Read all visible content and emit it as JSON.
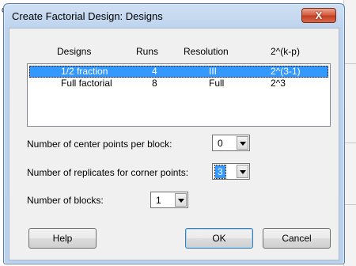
{
  "background": {
    "fragment_top": "C",
    "fragment_side": "ı"
  },
  "dialog": {
    "title": "Create Factorial Design: Designs",
    "close_label": "X",
    "columns": [
      "Designs",
      "Runs",
      "Resolution",
      "2^(k-p)"
    ],
    "designs": [
      {
        "design": "1/2 fraction",
        "runs": "4",
        "resolution": "III",
        "kp": "2^(3-1)",
        "selected": true
      },
      {
        "design": "Full factorial",
        "runs": "8",
        "resolution": "Full",
        "kp": "2^3",
        "selected": false
      }
    ],
    "center_points": {
      "label": "Number of center points per block:",
      "value": "0"
    },
    "replicates": {
      "label": "Number of replicates for corner points:",
      "value": "3"
    },
    "blocks": {
      "label": "Number of blocks:",
      "value": "1"
    },
    "buttons": {
      "help": "Help",
      "ok": "OK",
      "cancel": "Cancel"
    }
  },
  "colors": {
    "selection": "#3399ff",
    "title_bar": "#bed4ee",
    "close_button": "#c43c1f"
  }
}
